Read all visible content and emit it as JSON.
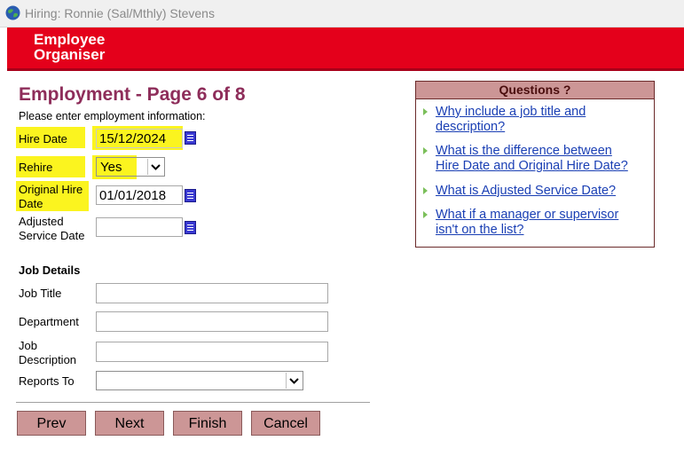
{
  "window": {
    "title": "Hiring: Ronnie (Sal/Mthly) Stevens",
    "icon": "globe-icon"
  },
  "banner": {
    "line1": "Employee",
    "line2": "Organiser"
  },
  "page": {
    "heading": "Employment - Page 6 of 8",
    "instruction": "Please enter employment information:"
  },
  "fields": {
    "hire_date": {
      "label": "Hire Date",
      "value": "15/12/2024"
    },
    "rehire": {
      "label": "Rehire",
      "value": "Yes"
    },
    "original_hire_date": {
      "label_line1": "Original Hire",
      "label_line2": "Date",
      "value": "01/01/2018"
    },
    "adjusted_service_date": {
      "label_line1": "Adjusted",
      "label_line2": "Service Date",
      "value": ""
    }
  },
  "job": {
    "section_title": "Job Details",
    "job_title": {
      "label": "Job Title",
      "value": ""
    },
    "department": {
      "label": "Department",
      "value": ""
    },
    "job_description": {
      "label_line1": "Job",
      "label_line2": "Description",
      "value": ""
    },
    "reports_to": {
      "label": "Reports To",
      "value": ""
    }
  },
  "buttons": {
    "prev": "Prev",
    "next": "Next",
    "finish": "Finish",
    "cancel": "Cancel"
  },
  "questions": {
    "header": "Questions ?",
    "items": [
      {
        "line1": "Why include a job title and",
        "line2": "description?"
      },
      {
        "line1": "What is the difference between",
        "line2": "Hire Date and Original Hire Date?"
      },
      {
        "line1": "What is Adjusted Service Date?",
        "line2": ""
      },
      {
        "line1": "What if a manager or supervisor",
        "line2": "isn't on the list?"
      }
    ]
  },
  "colors": {
    "banner_red": "#e4001b",
    "heading_purple": "#8e2d5a",
    "button_rose": "#cc9696",
    "highlight_yellow": "#fbf41f",
    "link_blue": "#1a3fb4"
  }
}
